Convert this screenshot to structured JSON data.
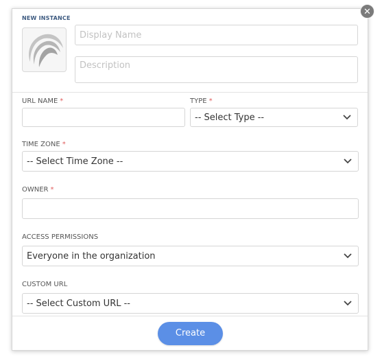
{
  "dialog": {
    "title": "NEW INSTANCE",
    "close_symbol": "✕",
    "logo_icon": "instance-swirl-logo"
  },
  "fields": {
    "display_name": {
      "placeholder": "Display Name",
      "value": ""
    },
    "description": {
      "placeholder": "Description",
      "value": ""
    },
    "url_name": {
      "label": "URL NAME",
      "required_mark": "*",
      "value": ""
    },
    "type": {
      "label": "TYPE",
      "required_mark": "*",
      "selected": "-- Select Type --"
    },
    "time_zone": {
      "label": "TIME ZONE",
      "required_mark": "*",
      "selected": "-- Select Time Zone --"
    },
    "owner": {
      "label": "OWNER",
      "required_mark": "*",
      "value": ""
    },
    "access_permissions": {
      "label": "ACCESS PERMISSIONS",
      "selected": "Everyone in the organization"
    },
    "custom_url": {
      "label": "CUSTOM URL",
      "selected": "-- Select Custom URL --"
    }
  },
  "footer": {
    "create_label": "Create"
  },
  "colors": {
    "accent": "#5b8fe6",
    "title": "#3d5a80",
    "required": "#e05d5d",
    "border": "#d5d5d5"
  }
}
